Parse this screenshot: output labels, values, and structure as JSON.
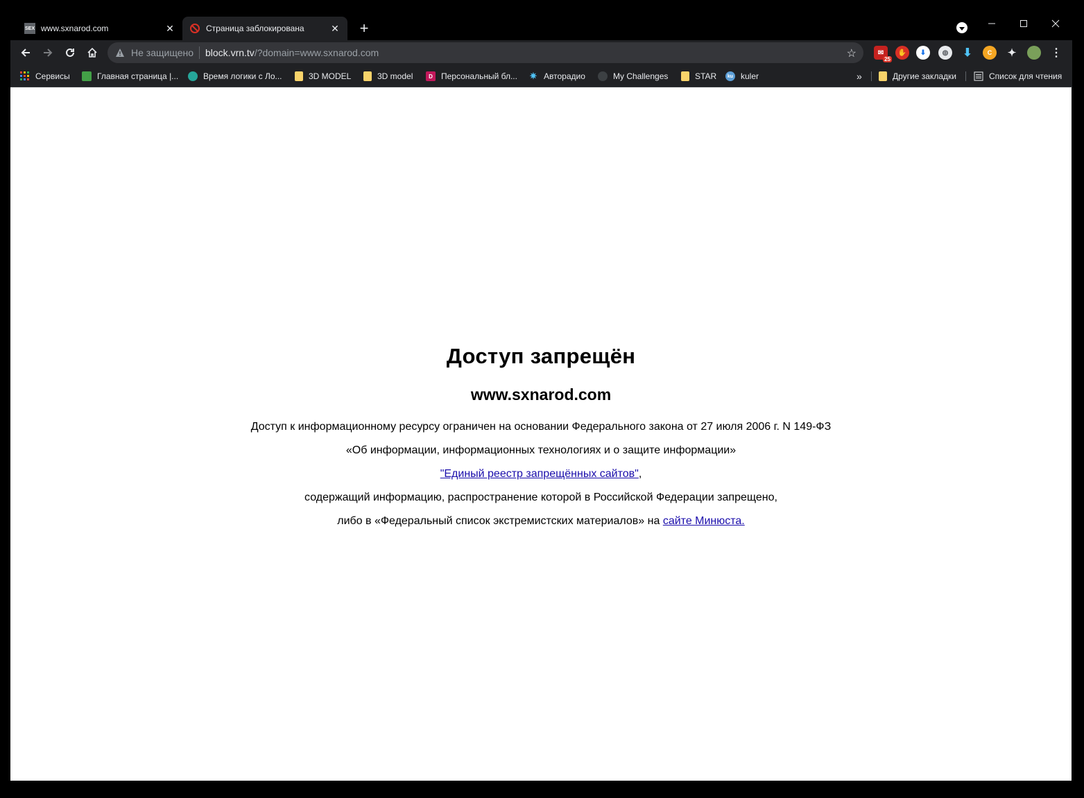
{
  "tabs": [
    {
      "title": "www.sxnarod.com",
      "favicon": "sex-site-icon",
      "favicon_text": "SEX"
    },
    {
      "title": "Страница заблокирована",
      "favicon": "blocked-icon"
    }
  ],
  "omnibox": {
    "security_label": "Не защищено",
    "host": "block.vrn.tv",
    "path": "/?domain=www.sxnarod.com"
  },
  "extensions": {
    "mail_badge": "25"
  },
  "bookmarks": [
    {
      "label": "Сервисы",
      "icon": "apps-grid-icon"
    },
    {
      "label": "Главная страница |...",
      "icon": "site-green-icon"
    },
    {
      "label": "Время логики с Ло...",
      "icon": "graduation-cap-icon"
    },
    {
      "label": "3D MODEL",
      "icon": "folder-icon"
    },
    {
      "label": "3D model",
      "icon": "folder-icon"
    },
    {
      "label": "Персональный бл...",
      "icon": "d-logo-icon"
    },
    {
      "label": "Авторадио",
      "icon": "star-burst-icon"
    },
    {
      "label": "My Challenges",
      "icon": "aperture-icon"
    },
    {
      "label": "STAR",
      "icon": "folder-icon"
    },
    {
      "label": "kuler",
      "icon": "kuler-icon"
    }
  ],
  "bookmarks_right": {
    "other": "Другие закладки",
    "reading_list": "Список для чтения"
  },
  "page": {
    "heading": "Доступ запрещён",
    "domain": "www.sxnarod.com",
    "line1": "Доступ к информационному ресурсу ограничен на основании Федерального закона от 27 июля 2006 г. N 149-ФЗ",
    "line2": "«Об информации, информационных технологиях и о защите информации»",
    "registry_link": "\"Единый реестр запрещённых сайтов\"",
    "registry_suffix": ",",
    "line4": "содержащий информацию, распространение которой в Российской Федерации запрещено,",
    "line5_prefix": "либо в «Федеральный список экстремистских материалов» на ",
    "minjust_link": "сайте Минюста."
  }
}
